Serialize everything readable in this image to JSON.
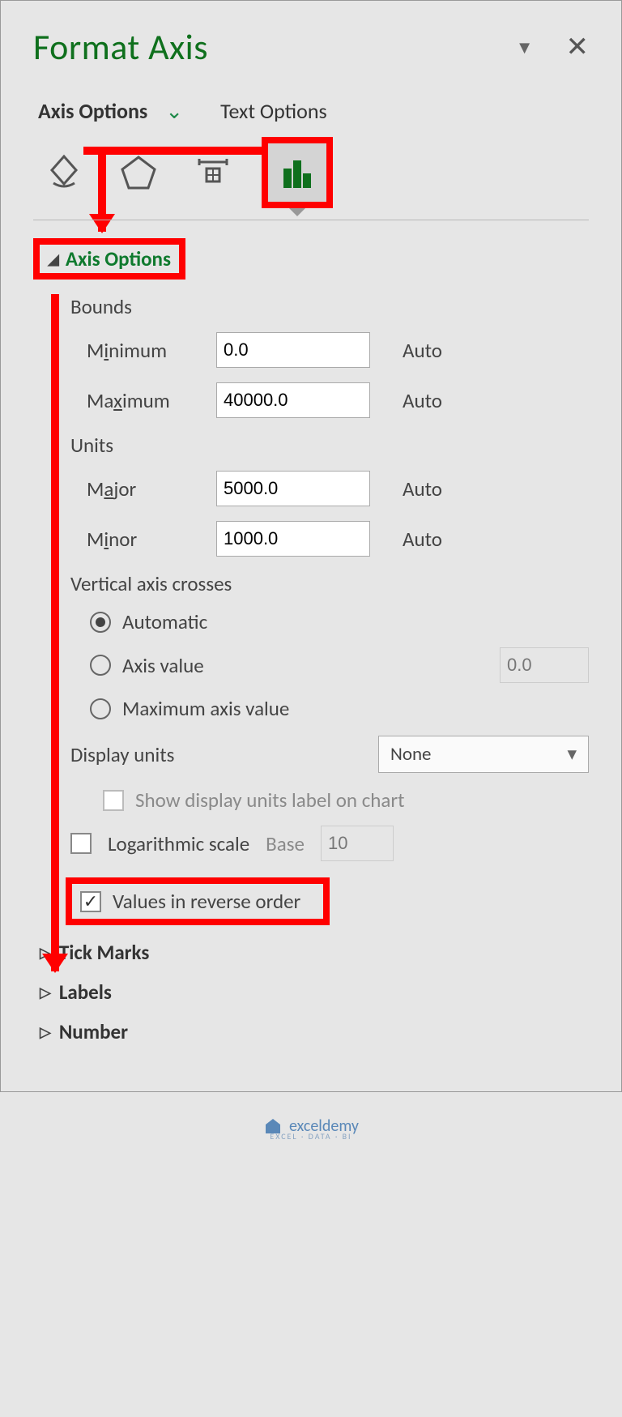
{
  "pane_title": "Format Axis",
  "top_tabs": {
    "axis": "Axis Options",
    "text": "Text Options"
  },
  "section": {
    "axis_options": "Axis Options",
    "bounds": "Bounds",
    "minimum": "Minimum",
    "maximum": "Maximum",
    "units": "Units",
    "major": "Major",
    "minor": "Minor",
    "crosses": "Vertical axis crosses",
    "automatic": "Automatic",
    "axis_value": "Axis value",
    "max_axis_value": "Maximum axis value",
    "display_units": "Display units",
    "show_units_label": "Show display units label on chart",
    "log_scale": "Logarithmic scale",
    "base": "Base",
    "reverse": "Values in reverse order",
    "tick_marks": "Tick Marks",
    "labels": "Labels",
    "number": "Number",
    "auto": "Auto"
  },
  "values": {
    "min": "0.0",
    "max": "40000.0",
    "major": "5000.0",
    "minor": "1000.0",
    "axis_value": "0.0",
    "display_units": "None",
    "base": "10"
  },
  "watermark": {
    "brand": "exceldemy",
    "sub": "EXCEL · DATA · BI"
  }
}
